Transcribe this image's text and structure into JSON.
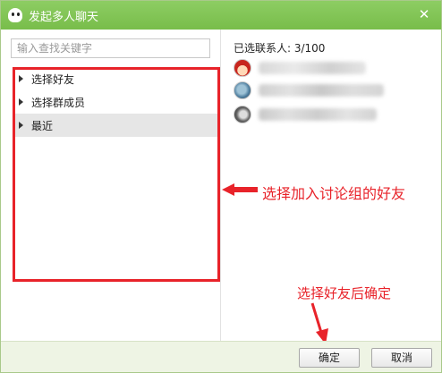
{
  "window": {
    "title": "发起多人聊天"
  },
  "search": {
    "placeholder": "输入查找关键字",
    "value": ""
  },
  "tree": {
    "items": [
      {
        "label": "选择好友",
        "selected": false
      },
      {
        "label": "选择群成员",
        "selected": false
      },
      {
        "label": "最近",
        "selected": true
      }
    ]
  },
  "selected_panel": {
    "count_label": "已选联系人: 3/100",
    "contacts": [
      {
        "avatar": "red-hat-girl-avatar",
        "name_blurred": true
      },
      {
        "avatar": "blue-avatar",
        "name_blurred": true
      },
      {
        "avatar": "dark-avatar",
        "name_blurred": true
      }
    ]
  },
  "annotations": {
    "pick_list_hint": "选择加入讨论组的好友",
    "confirm_hint": "选择好友后确定"
  },
  "buttons": {
    "ok": "确定",
    "cancel": "取消"
  },
  "colors": {
    "titlebar": "#7fc452",
    "annotation": "#e8232a",
    "bottom_bar": "#eef4e4"
  }
}
